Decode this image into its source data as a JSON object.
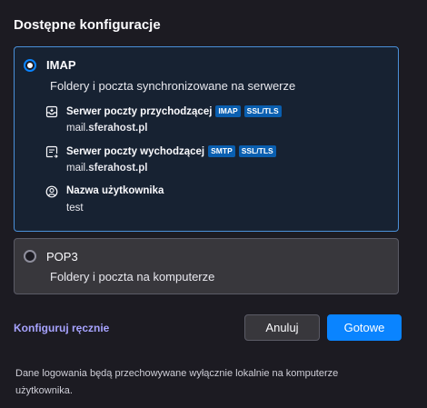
{
  "title": "Dostępne konfiguracje",
  "imap": {
    "protocol": "IMAP",
    "description": "Foldery i poczta synchronizowane na serwerze",
    "incoming": {
      "icon": "incoming-server-icon",
      "label": "Serwer poczty przychodzącej",
      "badges": [
        "IMAP",
        "SSL/TLS"
      ],
      "host_prefix": "mail.",
      "host_domain": "sferahost.pl"
    },
    "outgoing": {
      "icon": "outgoing-server-icon",
      "label": "Serwer poczty wychodzącej",
      "badges": [
        "SMTP",
        "SSL/TLS"
      ],
      "host_prefix": "mail.",
      "host_domain": "sferahost.pl"
    },
    "username": {
      "icon": "user-icon",
      "label": "Nazwa użytkownika",
      "value": "test"
    }
  },
  "pop3": {
    "protocol": "POP3",
    "description": "Foldery i poczta na komputerze"
  },
  "actions": {
    "configure_manually": "Konfiguruj ręcznie",
    "cancel": "Anuluj",
    "done": "Gotowe"
  },
  "footer": "Dane logowania będą przechowywane wyłącznie lokalnie na komputerze użytkownika.",
  "colors": {
    "accent": "#0a84ff",
    "link": "#a7a3ff",
    "badge": "#0a5fb0"
  }
}
